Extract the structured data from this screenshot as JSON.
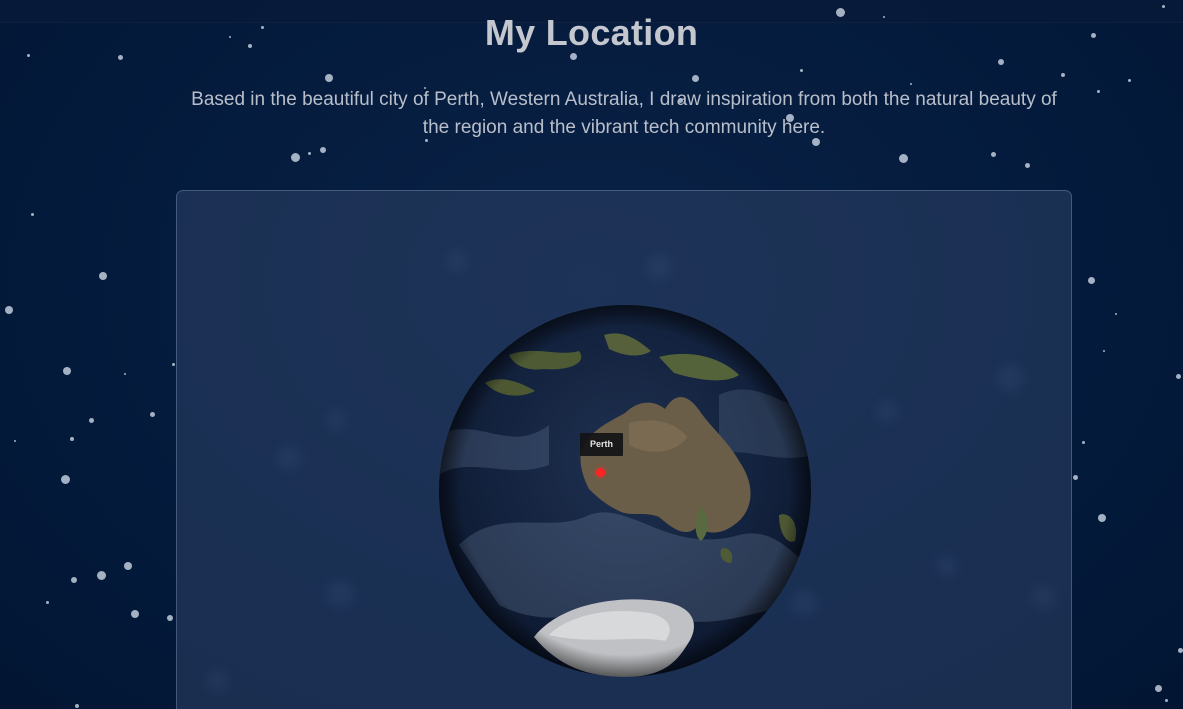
{
  "page": {
    "title": "My Location",
    "intro": "Based in the beautiful city of Perth, Western Australia, I draw inspiration from both the natural beauty of the region and the vibrant tech community here."
  },
  "map": {
    "marker_label": "Perth",
    "marker_color": "#ff2323",
    "globe_view": "Australia and Southern Ocean"
  },
  "theme": {
    "background": "#03193b",
    "card": "#2d4266"
  }
}
